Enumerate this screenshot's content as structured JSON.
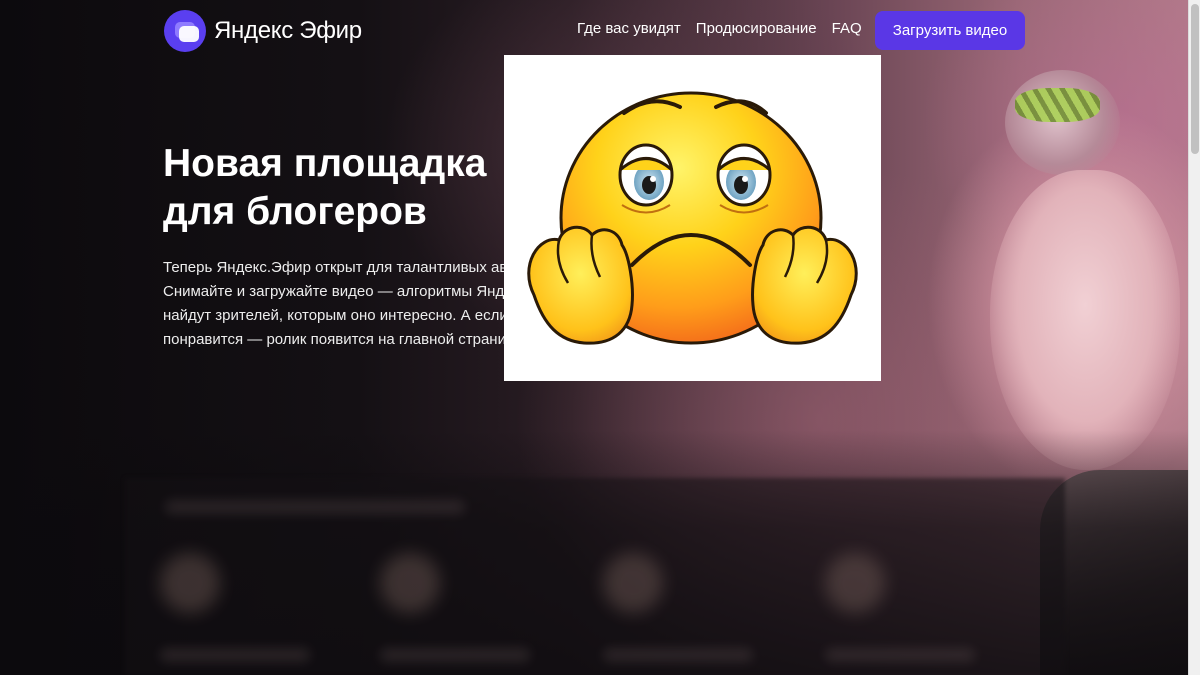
{
  "header": {
    "logo_text": "Яндекс Эфир",
    "nav": [
      {
        "label": "Где вас увидят"
      },
      {
        "label": "Продюсирование"
      },
      {
        "label": "FAQ"
      }
    ],
    "upload_label": "Загрузить видео"
  },
  "hero": {
    "title_lines": [
      "Новая площадка",
      "для блогеров"
    ],
    "description_lines": [
      "Теперь Яндекс.Эфир открыт для талантливых авт",
      "Снимайте и загружайте видео — алгоритмы Янд",
      "найдут зрителей, которым оно интересно. А если",
      "понравится — ролик появится на главной страни"
    ]
  },
  "overlay": {
    "icon": "sad-emoji-icon"
  },
  "colors": {
    "accent": "#5a37e6",
    "logo": "#5a3ff0",
    "background": "#0c0a0d"
  }
}
